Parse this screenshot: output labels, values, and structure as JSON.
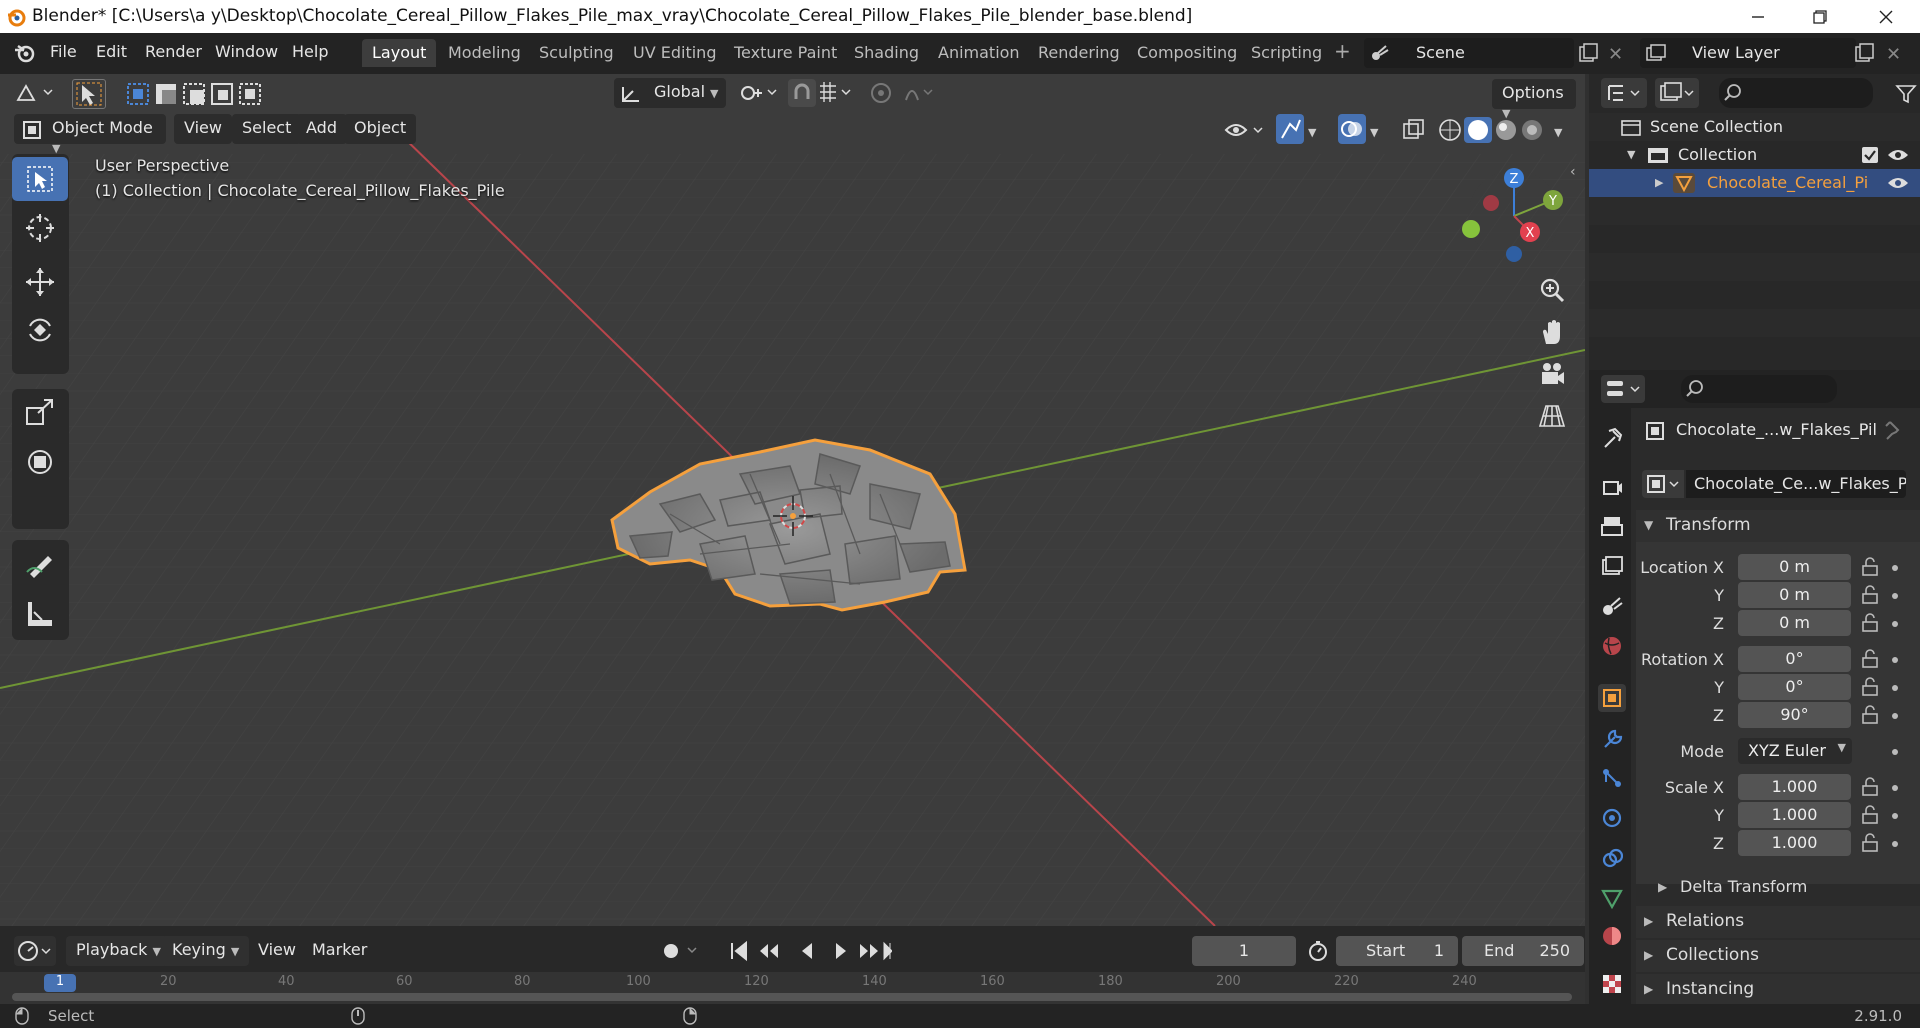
{
  "titlebar": {
    "title": "Blender* [C:\\Users\\a y\\Desktop\\Chocolate_Cereal_Pillow_Flakes_Pile_max_vray\\Chocolate_Cereal_Pillow_Flakes_Pile_blender_base.blend]"
  },
  "menu": {
    "file": "File",
    "edit": "Edit",
    "render": "Render",
    "window": "Window",
    "help": "Help"
  },
  "workspaces": [
    "Layout",
    "Modeling",
    "Sculpting",
    "UV Editing",
    "Texture Paint",
    "Shading",
    "Animation",
    "Rendering",
    "Compositing",
    "Scripting"
  ],
  "active_workspace": "Layout",
  "scene": {
    "name": "Scene",
    "view_layer": "View Layer"
  },
  "viewport": {
    "transform_orientation": "Global",
    "options_label": "Options",
    "mode": "Object Mode",
    "header_menus": {
      "view": "View",
      "select": "Select",
      "add": "Add",
      "object": "Object"
    },
    "perspective_label": "User Perspective",
    "collection_label": "(1) Collection | Chocolate_Cereal_Pillow_Flakes_Pile",
    "gizmo": {
      "x": "X",
      "y": "Y",
      "z": "Z"
    }
  },
  "outliner": {
    "scene_collection": "Scene Collection",
    "collection": "Collection",
    "object": "Chocolate_Cereal_Pi"
  },
  "properties": {
    "object_name_short": "Chocolate_...w_Flakes_Pil",
    "object_datablock": "Chocolate_Ce...w_Flakes_Pile",
    "transform_label": "Transform",
    "location_x_label": "Location X",
    "rotation_x_label": "Rotation X",
    "scale_x_label": "Scale X",
    "y_label": "Y",
    "z_label": "Z",
    "mode_label": "Mode",
    "location": [
      "0 m",
      "0 m",
      "0 m"
    ],
    "rotation": [
      "0°",
      "0°",
      "90°"
    ],
    "rotation_mode": "XYZ Euler",
    "scale": [
      "1.000",
      "1.000",
      "1.000"
    ],
    "delta_transform": "Delta Transform",
    "relations": "Relations",
    "collections": "Collections",
    "instancing": "Instancing"
  },
  "timeline": {
    "playback": "Playback",
    "keying": "Keying",
    "view": "View",
    "marker": "Marker",
    "current_frame": "1",
    "start_label": "Start",
    "start": "1",
    "end_label": "End",
    "end": "250",
    "ruler_ticks": [
      "1",
      "20",
      "40",
      "60",
      "80",
      "100",
      "120",
      "140",
      "160",
      "180",
      "200",
      "220",
      "240"
    ]
  },
  "statusbar": {
    "select": "Select",
    "version": "2.91.0"
  },
  "colors": {
    "accent": "#4772b3",
    "selection": "#f5a03d",
    "x_axis": "#c0454d",
    "y_axis": "#7ea53c",
    "z_axis": "#3d7fd8"
  }
}
